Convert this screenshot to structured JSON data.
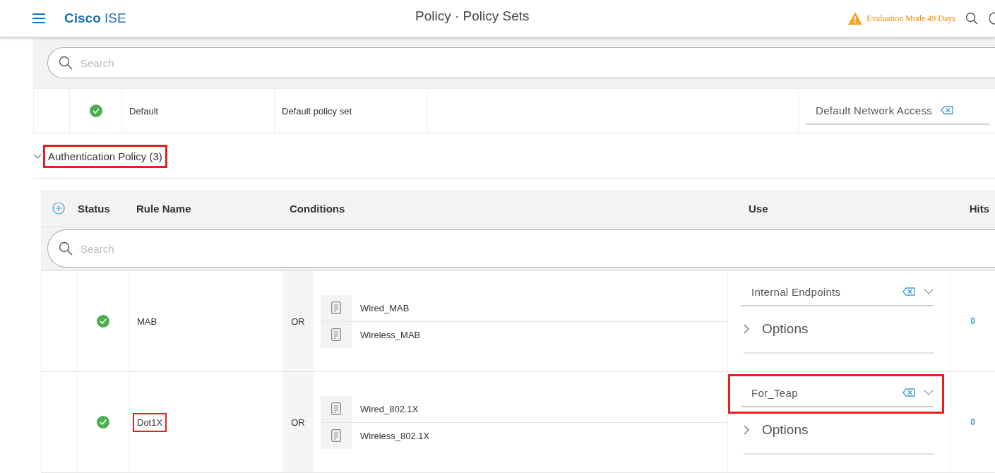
{
  "header": {
    "brand": "Cisco",
    "product": "ISE",
    "title": "Policy · Policy Sets",
    "notice": "Evaluation Mode 49 Days"
  },
  "policy_set": {
    "search": {
      "placeholder": "Search"
    },
    "row": {
      "enabled": true,
      "name": "Default",
      "description": "Default policy set",
      "allowed_protocols": "Default Network Access"
    }
  },
  "section": {
    "title": "Authentication Policy (3)",
    "expanded": true,
    "highlighted": true
  },
  "table": {
    "columns": [
      "Status",
      "Rule Name",
      "Conditions",
      "Use",
      "Hits"
    ],
    "search": {
      "placeholder": "Search"
    },
    "rows": [
      {
        "enabled": true,
        "name": "MAB",
        "name_highlighted": false,
        "operator": "OR",
        "conditions": [
          "Wired_MAB",
          "Wireless_MAB"
        ],
        "use": "Internal Endpoints",
        "use_highlighted": false,
        "options": "Options",
        "hits": "0"
      },
      {
        "enabled": true,
        "name": "Dot1X",
        "name_highlighted": true,
        "operator": "OR",
        "conditions": [
          "Wired_802.1X",
          "Wireless_802.1X"
        ],
        "use": "For_Teap",
        "use_highlighted": true,
        "options": "Options",
        "hits": "0"
      }
    ]
  }
}
